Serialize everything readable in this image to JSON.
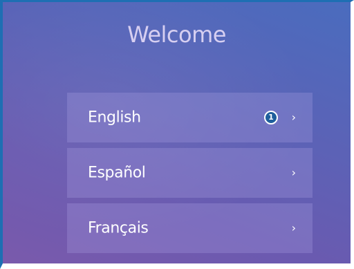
{
  "screen": {
    "title": "Welcome"
  },
  "languages": [
    {
      "label": "English",
      "badge": "1",
      "chevron": "›"
    },
    {
      "label": "Español",
      "chevron": "›"
    },
    {
      "label": "Français",
      "chevron": "›"
    }
  ],
  "colors": {
    "frame_accent": "#1e6fb3",
    "badge_fill": "#1f5f9c",
    "gradient_start": "#7a5aac",
    "gradient_end": "#4a6cbe"
  },
  "icons": {
    "chevron": "chevron-right-icon",
    "badge": "numbered-step-badge-icon"
  }
}
